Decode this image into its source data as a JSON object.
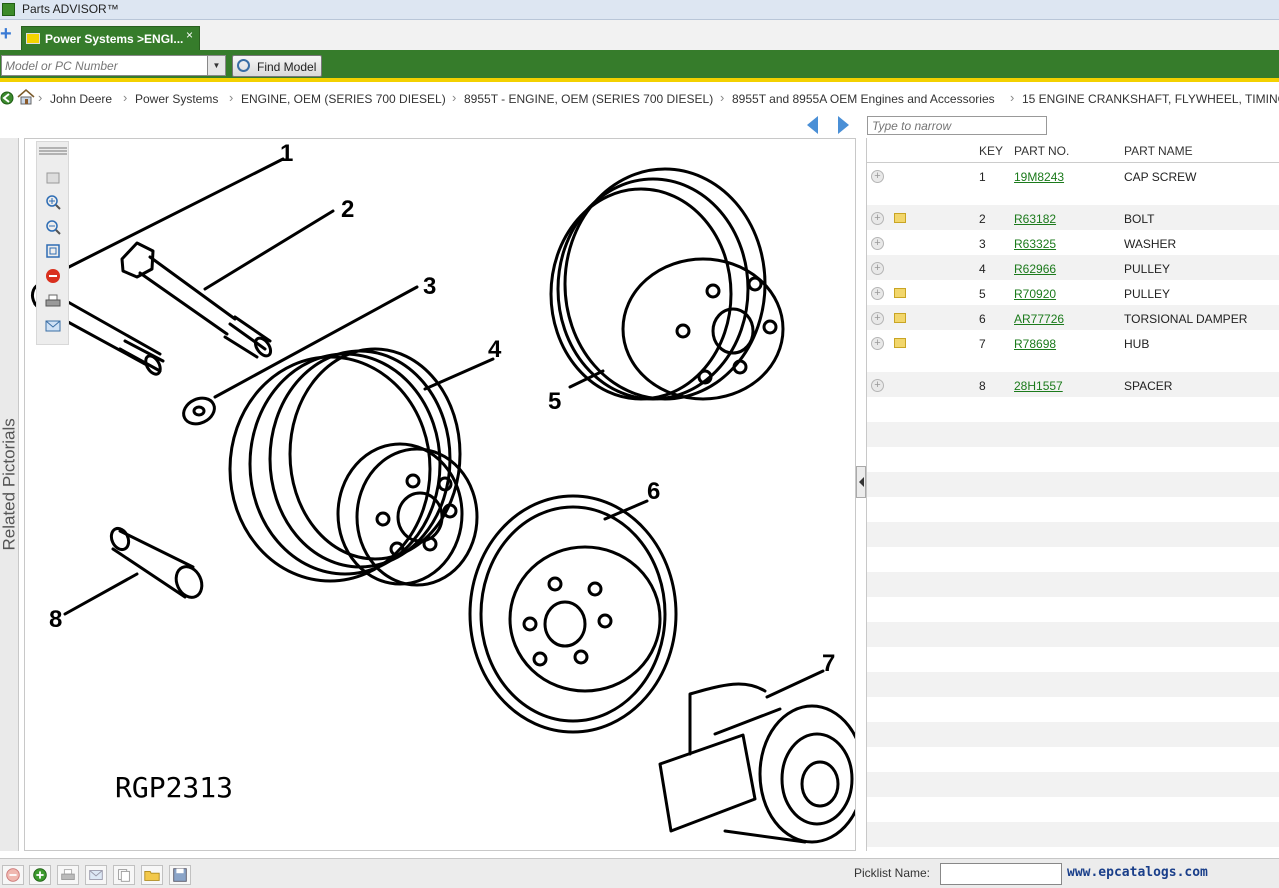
{
  "app": {
    "title": "Parts ADVISOR™"
  },
  "tab": {
    "label": "Power Systems >ENGI...",
    "close": "×"
  },
  "search": {
    "placeholder": "Model or PC Number",
    "find_label": "Find Model"
  },
  "breadcrumbs": [
    "John Deere",
    "Power Systems",
    "ENGINE, OEM (SERIES 700 DIESEL)",
    "8955T - ENGINE, OEM (SERIES 700 DIESEL)",
    "8955T and 8955A OEM Engines and Accessories",
    "15 ENGINE CRANKSHAFT, FLYWHEEL, TIMING"
  ],
  "narrow": {
    "placeholder": "Type to narrow"
  },
  "side_panel": {
    "label": "Related Pictorials"
  },
  "illustration": {
    "code": "RGP2313",
    "callouts": [
      "1",
      "2",
      "3",
      "4",
      "5",
      "6",
      "7",
      "8"
    ]
  },
  "parts_table": {
    "columns": [
      "KEY",
      "PART NO.",
      "PART NAME"
    ],
    "rows": [
      {
        "key": "1",
        "part_no": "19M8243",
        "part_name": "CAP SCREW",
        "has_note": false
      },
      {
        "key": "2",
        "part_no": "R63182",
        "part_name": "BOLT",
        "has_note": true
      },
      {
        "key": "3",
        "part_no": "R63325",
        "part_name": "WASHER",
        "has_note": false
      },
      {
        "key": "4",
        "part_no": "R62966",
        "part_name": "PULLEY",
        "has_note": false
      },
      {
        "key": "5",
        "part_no": "R70920",
        "part_name": "PULLEY",
        "has_note": true
      },
      {
        "key": "6",
        "part_no": "AR77726",
        "part_name": "TORSIONAL DAMPER",
        "has_note": true
      },
      {
        "key": "7",
        "part_no": "R78698",
        "part_name": "HUB",
        "has_note": true
      },
      {
        "key": "8",
        "part_no": "28H1557",
        "part_name": "SPACER",
        "has_note": false
      }
    ]
  },
  "footer": {
    "picklist_label": "Picklist Name:",
    "watermark": "www.epcatalogs.com"
  },
  "colors": {
    "brand_green": "#367c2b",
    "brand_yellow": "#f3d100",
    "link_green": "#1b7a1b"
  }
}
